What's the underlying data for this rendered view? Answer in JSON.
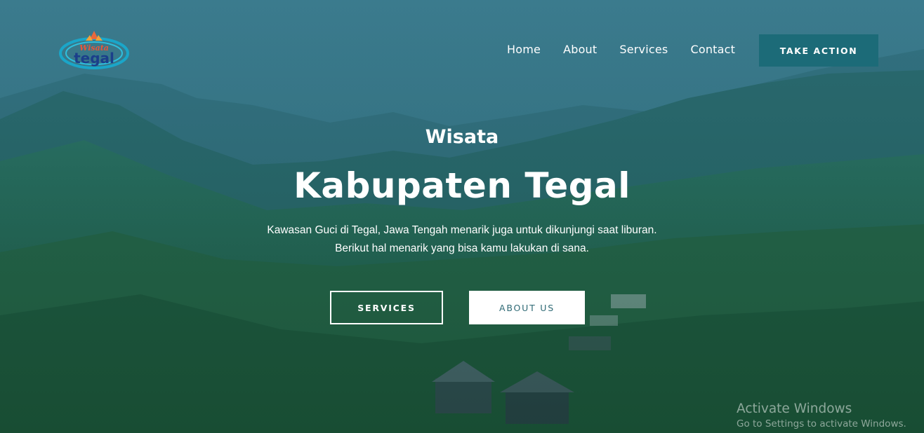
{
  "logo": {
    "line1": "Wisata",
    "line2": "tegal"
  },
  "nav": {
    "items": [
      {
        "label": "Home"
      },
      {
        "label": "About"
      },
      {
        "label": "Services"
      },
      {
        "label": "Contact"
      }
    ],
    "cta_label": "TAKE ACTION"
  },
  "hero": {
    "subtitle": "Wisata",
    "title": "Kabupaten Tegal",
    "description_line1": "Kawasan Guci di Tegal, Jawa Tengah menarik juga untuk dikunjungi saat liburan.",
    "description_line2": "Berikut hal menarik yang bisa kamu lakukan di sana.",
    "services_button": "SERVICES",
    "about_button": "ABOUT US"
  },
  "watermark": {
    "title": "Activate Windows",
    "subtitle": "Go to Settings to activate Windows."
  },
  "colors": {
    "overlay": "#1f5f6b",
    "cta": "#1c6b78",
    "about_text": "#2f6a75"
  }
}
